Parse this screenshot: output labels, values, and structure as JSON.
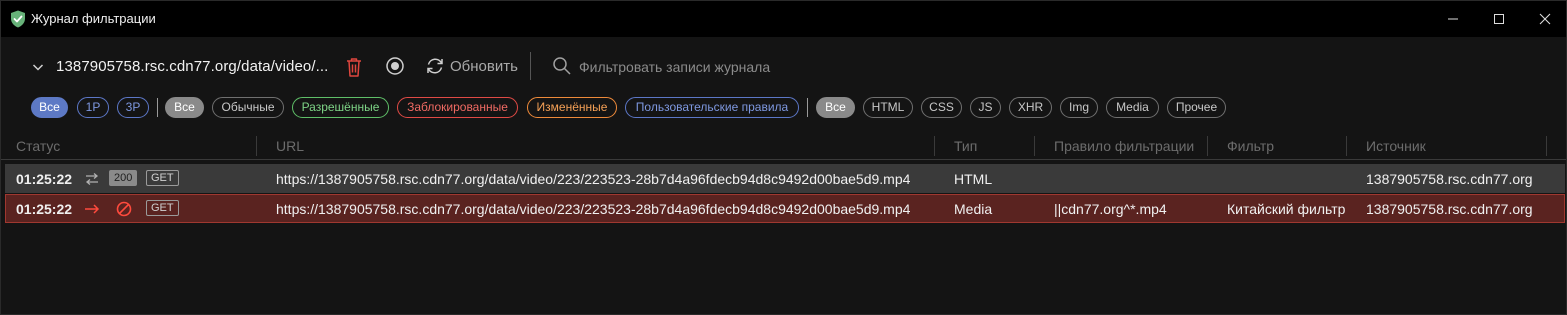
{
  "window": {
    "title": "Журнал фильтрации",
    "accent": "#67b279"
  },
  "toolbar": {
    "url": "1387905758.rsc.cdn77.org/data/video/...",
    "refresh_label": "Обновить",
    "search_placeholder": "Фильтровать записи журнала"
  },
  "filters": {
    "party": [
      "Все",
      "1P",
      "3P"
    ],
    "kind": [
      "Все",
      "Обычные",
      "Разрешённые",
      "Заблокированные",
      "Изменённые",
      "Пользовательские правила"
    ],
    "type": [
      "Все",
      "HTML",
      "CSS",
      "JS",
      "XHR",
      "Img",
      "Media",
      "Прочее"
    ]
  },
  "table": {
    "columns": [
      "Статус",
      "URL",
      "Тип",
      "Правило фильтрации",
      "Фильтр",
      "Источник"
    ],
    "rows": [
      {
        "time": "01:25:22",
        "status_code": "200",
        "method": "GET",
        "url": "https://1387905758.rsc.cdn77.org/data/video/223/223523-28b7d4a96fdecb94d8c9492d00bae5d9.mp4",
        "type": "HTML",
        "rule": "",
        "filter": "",
        "source": "1387905758.rsc.cdn77.org"
      },
      {
        "time": "01:25:22",
        "method": "GET",
        "url": "https://1387905758.rsc.cdn77.org/data/video/223/223523-28b7d4a96fdecb94d8c9492d00bae5d9.mp4",
        "type": "Media",
        "rule": "||cdn77.org^*.mp4",
        "filter": "Китайский фильтр",
        "source": "1387905758.rsc.cdn77.org"
      }
    ]
  }
}
